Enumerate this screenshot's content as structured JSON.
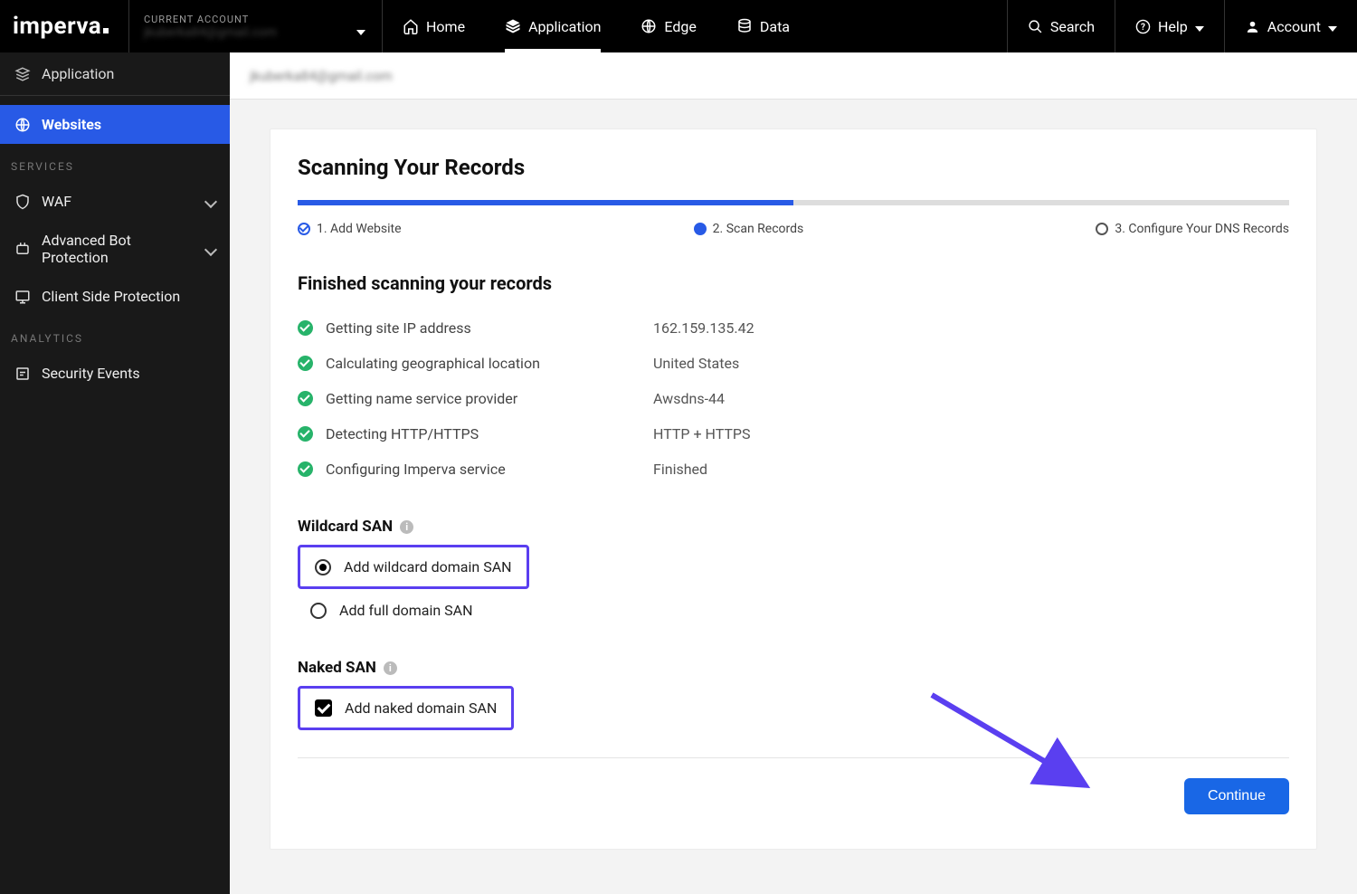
{
  "brand": "imperva",
  "topbar": {
    "current_account_label": "CURRENT ACCOUNT",
    "current_account_value": "jkuberka84@gmail.com",
    "nav": {
      "home": "Home",
      "application": "Application",
      "edge": "Edge",
      "data": "Data"
    },
    "search": "Search",
    "help": "Help",
    "account": "Account"
  },
  "sidebar": {
    "group": "Application",
    "websites": "Websites",
    "services_label": "SERVICES",
    "waf": "WAF",
    "abp": "Advanced Bot Protection",
    "csp": "Client Side Protection",
    "analytics_label": "ANALYTICS",
    "security_events": "Security Events"
  },
  "breadcrumb": "jkuberka84@gmail.com",
  "page": {
    "title": "Scanning Your Records",
    "progress_percent": 50,
    "steps": {
      "s1": "1. Add Website",
      "s2": "2. Scan Records",
      "s3": "3. Configure Your DNS Records"
    },
    "finished_heading": "Finished scanning your records",
    "results": [
      {
        "label": "Getting site IP address",
        "value": "162.159.135.42"
      },
      {
        "label": "Calculating geographical location",
        "value": "United States"
      },
      {
        "label": "Getting name service provider",
        "value": "Awsdns-44"
      },
      {
        "label": "Detecting HTTP/HTTPS",
        "value": "HTTP + HTTPS"
      },
      {
        "label": "Configuring Imperva service",
        "value": "Finished"
      }
    ],
    "wildcard_san_heading": "Wildcard SAN",
    "wildcard_opt1": "Add wildcard domain SAN",
    "wildcard_opt2": "Add full domain SAN",
    "naked_san_heading": "Naked SAN",
    "naked_opt": "Add naked domain SAN",
    "continue": "Continue"
  }
}
